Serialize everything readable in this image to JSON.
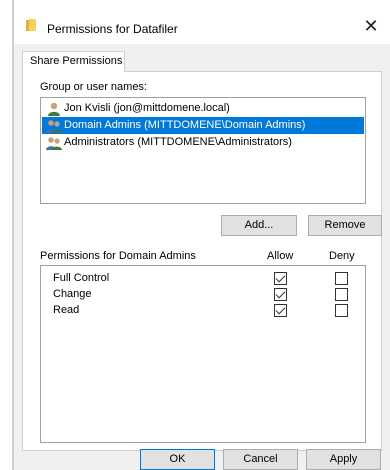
{
  "window": {
    "title": "Permissions for Datafiler",
    "close_glyph": "✕",
    "accent_color": "#0078d7",
    "icon": "folder-icon"
  },
  "tabs": [
    {
      "label": "Share Permissions",
      "active": true
    }
  ],
  "group_section": {
    "label": "Group or user names:",
    "items": [
      {
        "label": "Jon Kvisli (jon@mittdomene.local)",
        "icon": "user-icon",
        "selected": false
      },
      {
        "label": "Domain Admins (MITTDOMENE\\Domain Admins)",
        "icon": "group-icon",
        "selected": true
      },
      {
        "label": "Administrators (MITTDOMENE\\Administrators)",
        "icon": "group-icon",
        "selected": false
      }
    ],
    "add_label": "Add...",
    "remove_label": "Remove"
  },
  "permissions": {
    "label": "Permissions for Domain Admins",
    "allow_header": "Allow",
    "deny_header": "Deny",
    "rows": [
      {
        "name": "Full Control",
        "allow": true,
        "deny": false
      },
      {
        "name": "Change",
        "allow": true,
        "deny": false
      },
      {
        "name": "Read",
        "allow": true,
        "deny": false
      }
    ]
  },
  "footer": {
    "ok_label": "OK",
    "cancel_label": "Cancel",
    "apply_label": "Apply"
  }
}
